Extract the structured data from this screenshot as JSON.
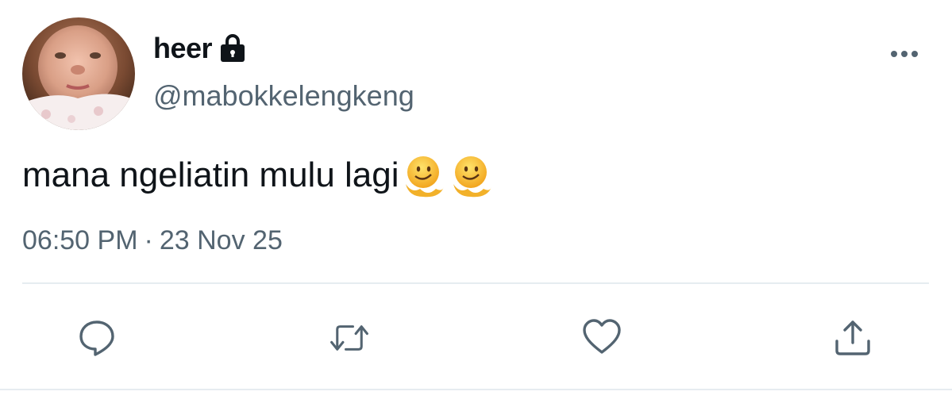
{
  "user": {
    "display_name": "heer",
    "handle": "@mabokkelengkeng",
    "protected_icon": "lock-icon",
    "avatar": "avatar-photo"
  },
  "tweet": {
    "text": "mana ngeliatin mulu lagi",
    "emoji": [
      "melting-face-emoji",
      "melting-face-emoji"
    ],
    "time": "06:50 PM",
    "separator": "·",
    "date": "23 Nov 25"
  },
  "actions": [
    {
      "name": "reply",
      "icon": "reply-icon"
    },
    {
      "name": "retweet",
      "icon": "retweet-icon"
    },
    {
      "name": "like",
      "icon": "heart-icon"
    },
    {
      "name": "share",
      "icon": "share-icon"
    }
  ],
  "colors": {
    "text_primary": "#0f1419",
    "text_secondary": "#536471",
    "divider": "#e6ecf0",
    "icon": "#536471"
  }
}
